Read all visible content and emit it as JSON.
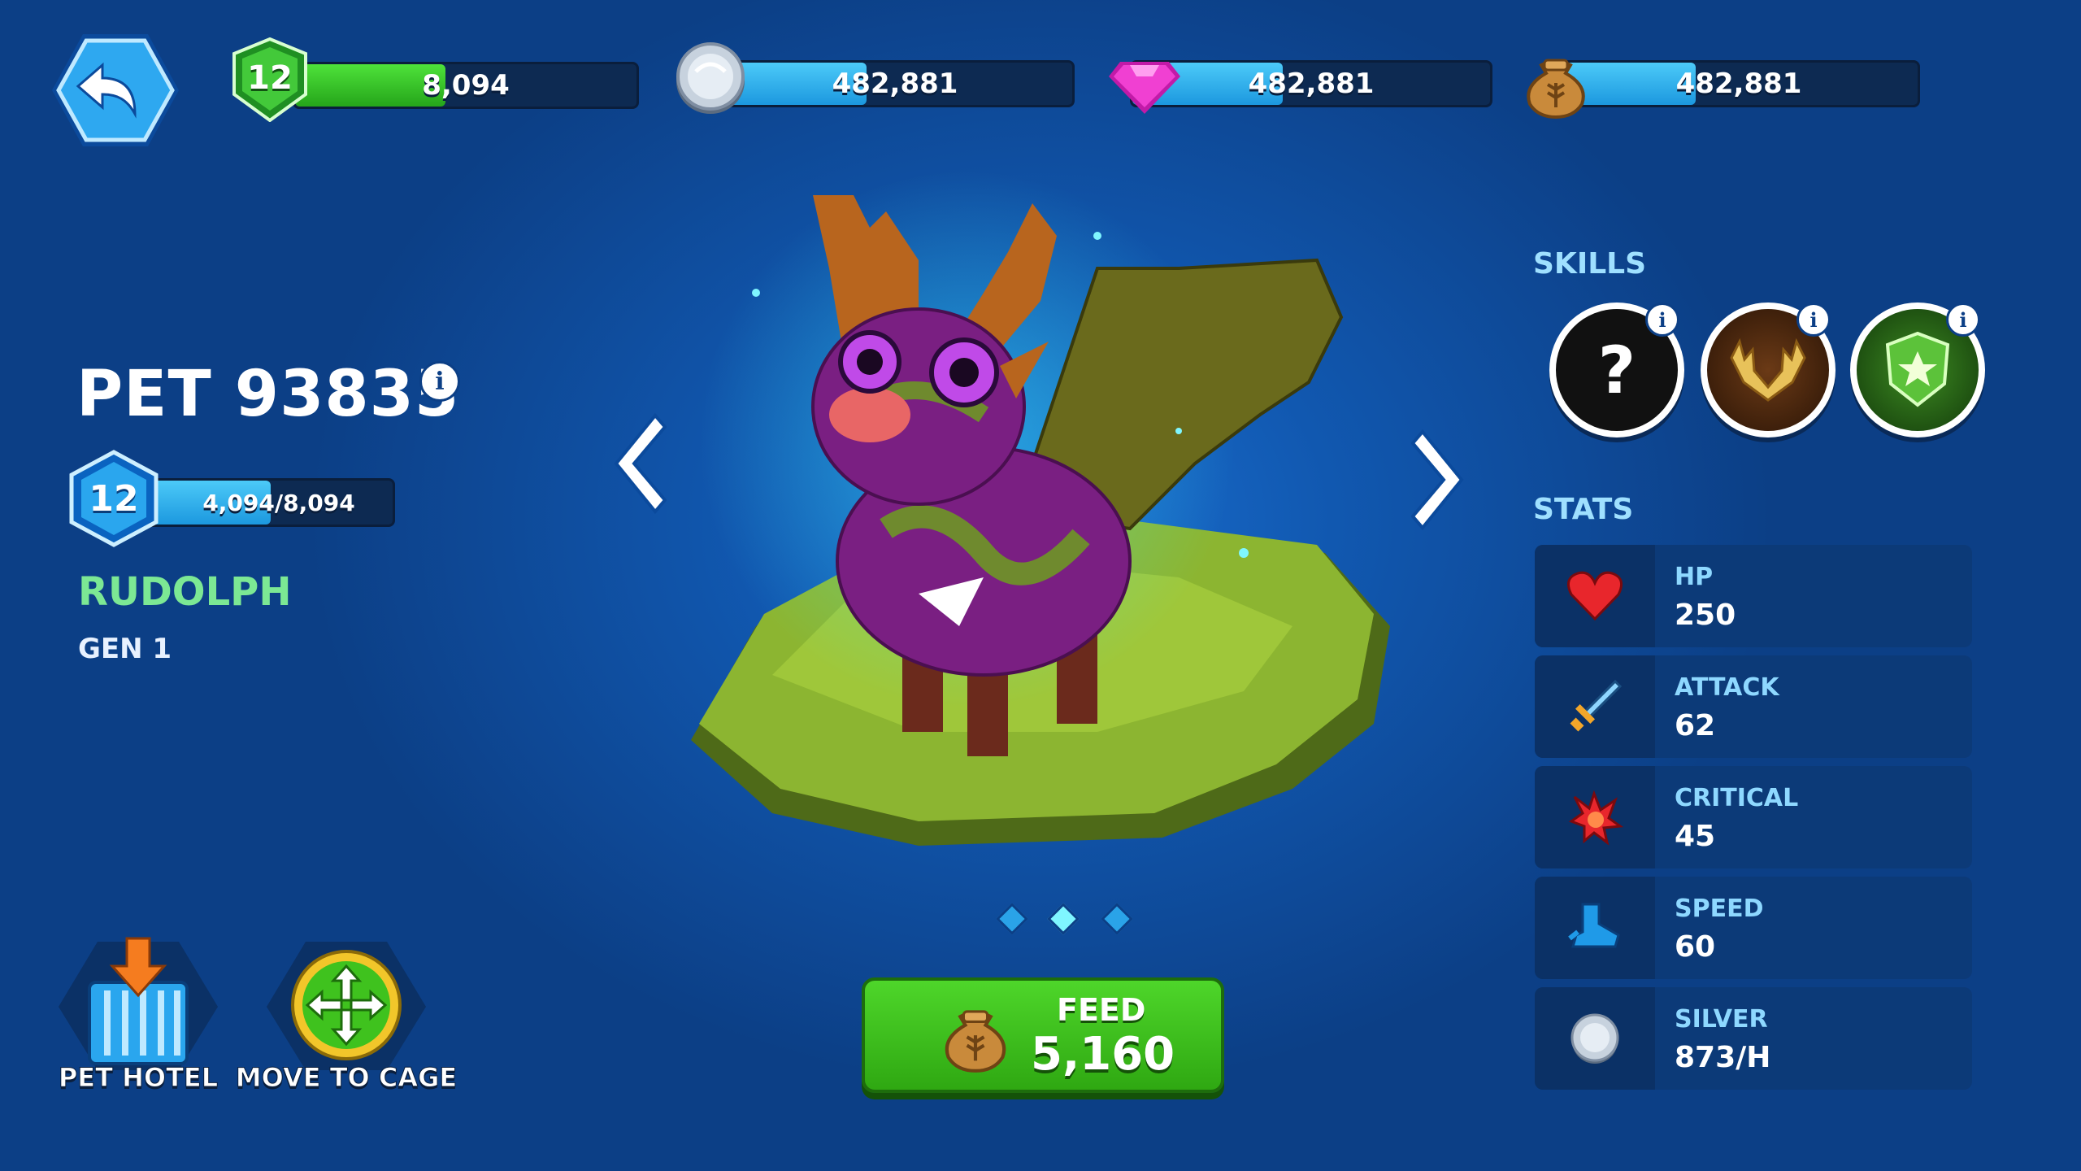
{
  "top_bar": {
    "player_level": "12",
    "player_xp": "8,094",
    "player_xp_fraction": 0.44,
    "silver": "482,881",
    "silver_fraction": 0.42,
    "gems": "482,881",
    "gems_fraction": 0.42,
    "food": "482,881",
    "food_fraction": 0.38
  },
  "pet": {
    "name": "PET 93835",
    "level": "12",
    "xp": "4,094/8,094",
    "xp_fraction": 0.5,
    "type": "RUDOLPH",
    "generation": "GEN 1"
  },
  "skills": {
    "title": "SKILLS",
    "items": [
      {
        "name": "unknown-skill-icon",
        "glyph": "?"
      },
      {
        "name": "antler-skill-icon"
      },
      {
        "name": "shield-star-skill-icon"
      }
    ]
  },
  "stats": {
    "title": "STATS",
    "items": [
      {
        "label": "HP",
        "value": "250",
        "icon": "heart-icon"
      },
      {
        "label": "ATTACK",
        "value": "62",
        "icon": "sword-icon"
      },
      {
        "label": "CRITICAL",
        "value": "45",
        "icon": "critical-burst-icon"
      },
      {
        "label": "SPEED",
        "value": "60",
        "icon": "boot-icon"
      },
      {
        "label": "SILVER",
        "value": "873/H",
        "icon": "silver-coin-icon"
      }
    ]
  },
  "actions": {
    "pet_hotel": "PET HOTEL",
    "move_to_cage": "MOVE TO CAGE",
    "feed_label": "FEED",
    "feed_cost": "5,160"
  },
  "carousel": {
    "active_index": 1,
    "count": 3
  },
  "colors": {
    "background": "#1158b0",
    "xp_green": "#3ccd2e",
    "resource_blue": "#27b3ef",
    "pet_type_green": "#7ce894",
    "feed_green": "#3fc21e"
  }
}
